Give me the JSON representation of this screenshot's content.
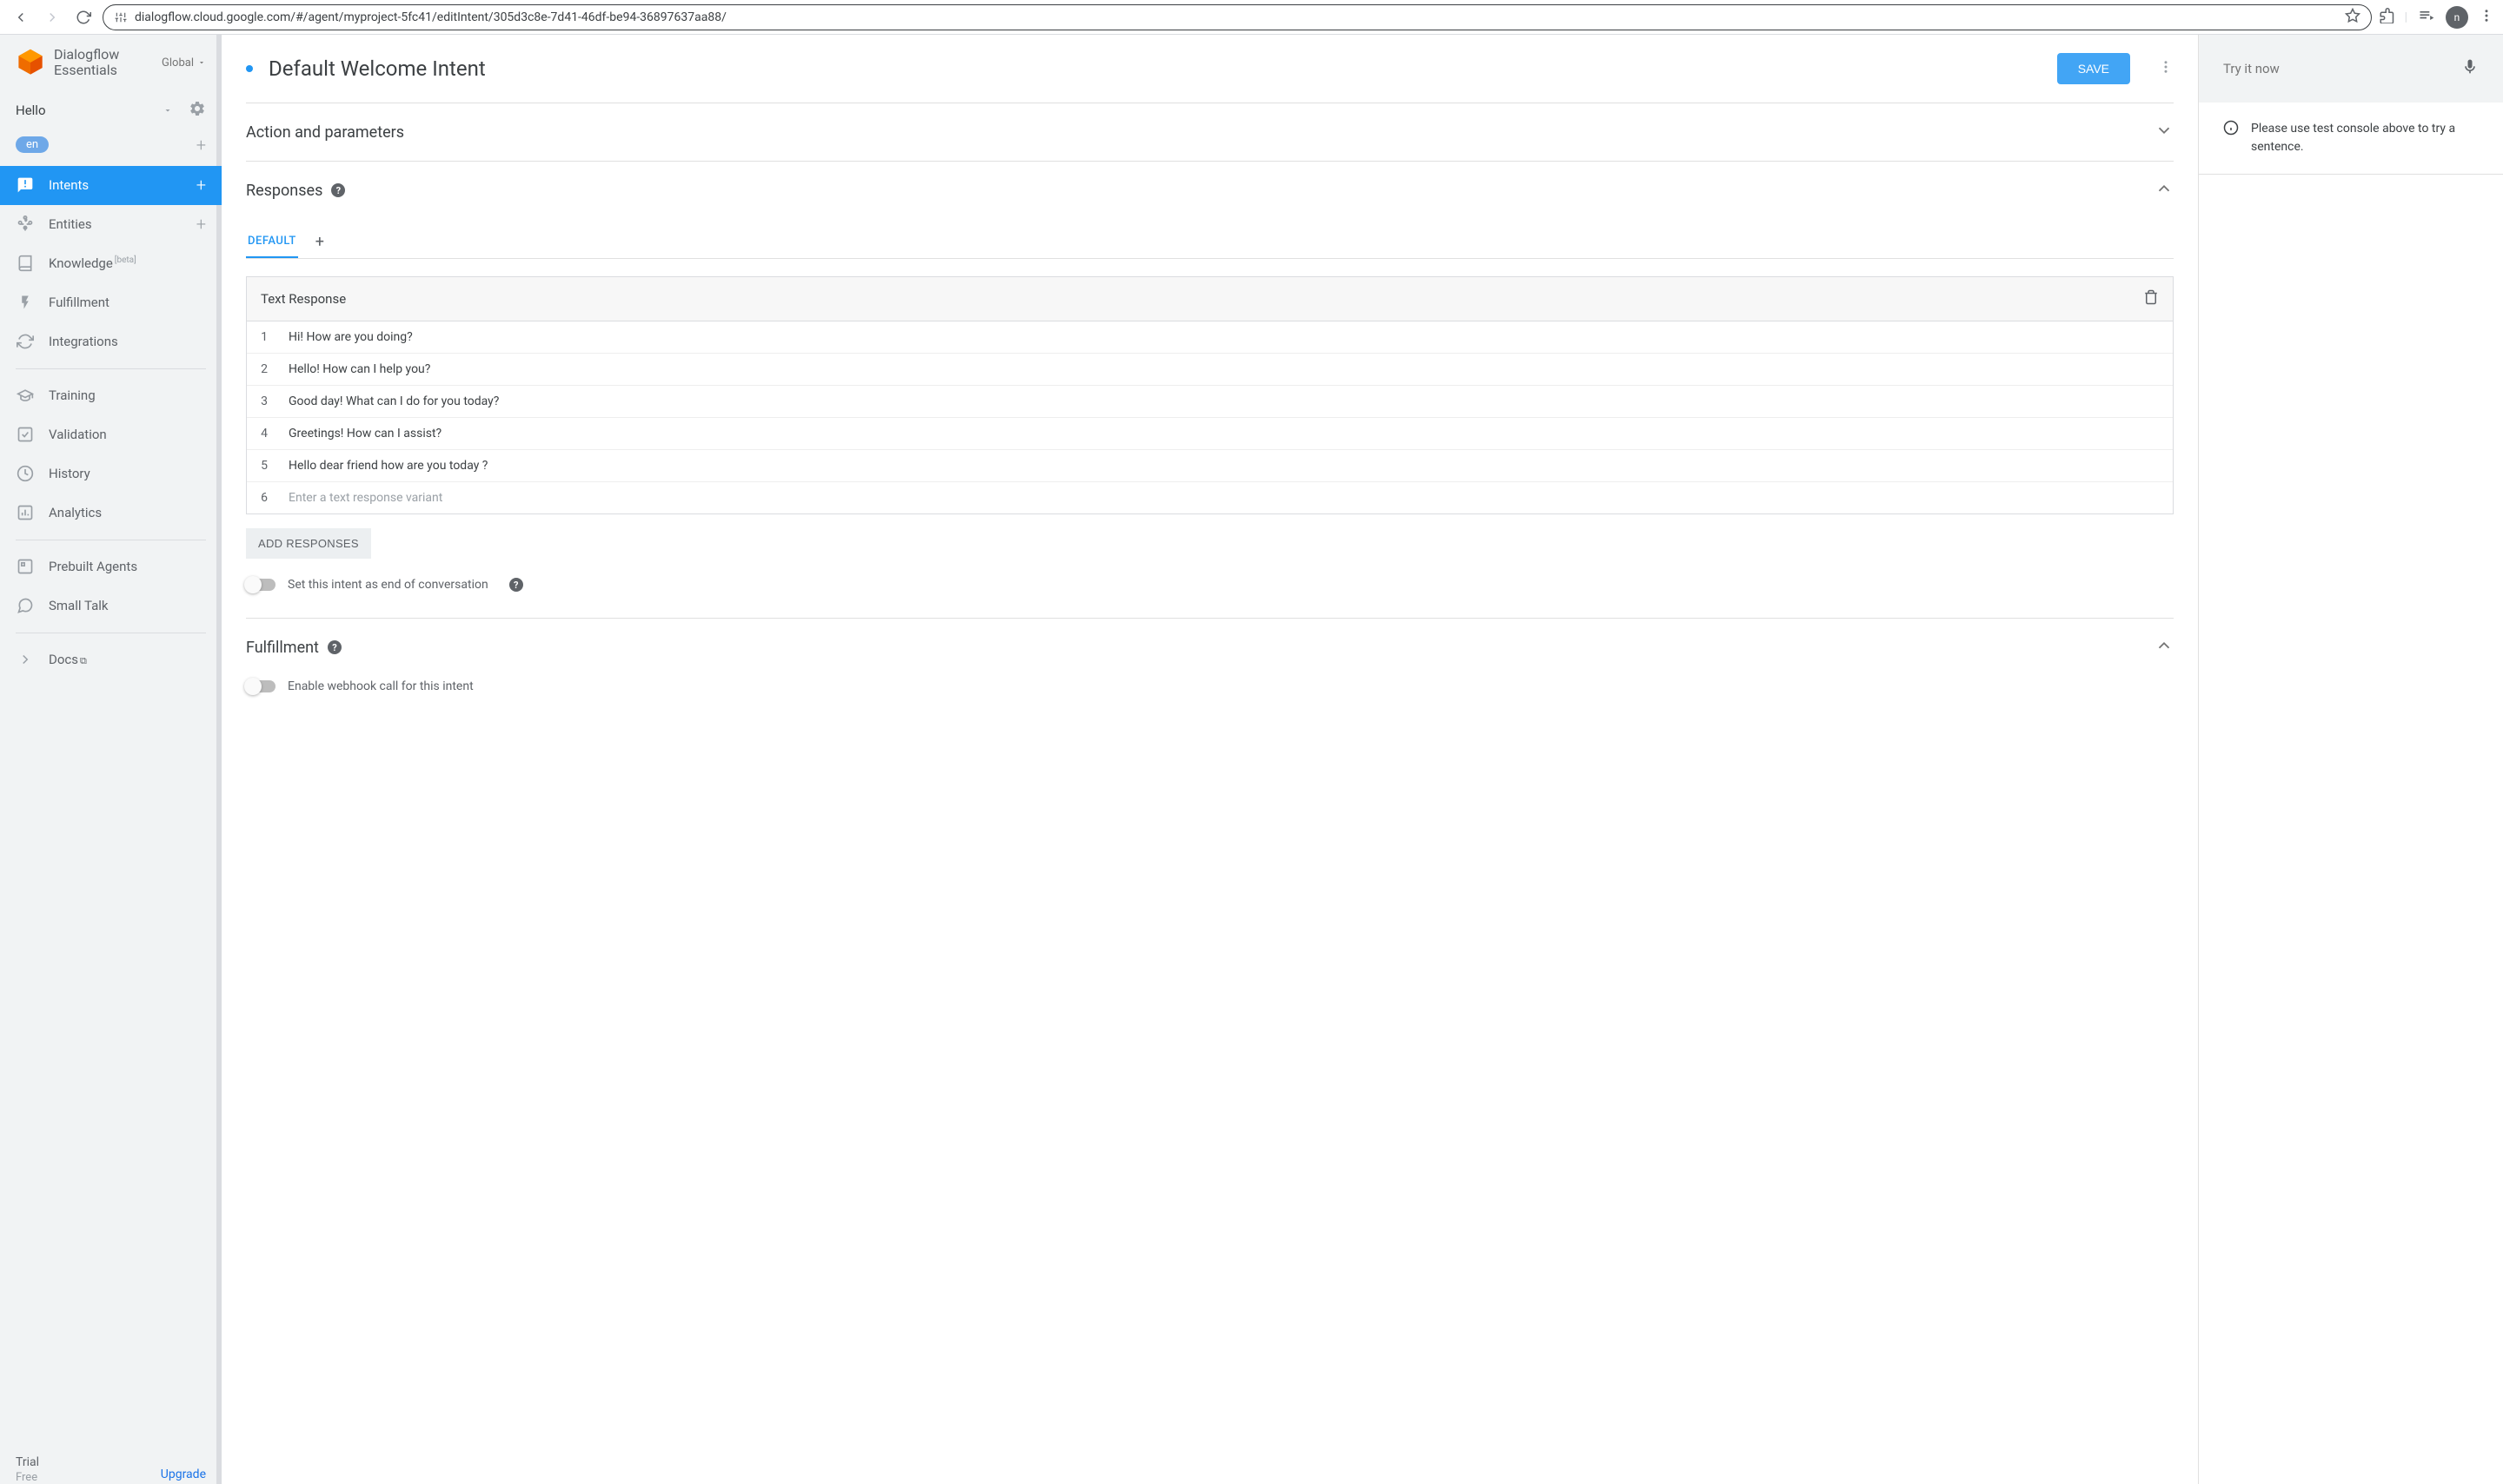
{
  "browser": {
    "url": "dialogflow.cloud.google.com/#/agent/myproject-5fc41/editIntent/305d3c8e-7d41-46df-be94-36897637aa88/",
    "avatar_letter": "n"
  },
  "logo": {
    "line1": "Dialogflow",
    "line2": "Essentials",
    "scope": "Global"
  },
  "agent": {
    "name": "Hello",
    "lang": "en"
  },
  "nav": {
    "intents": "Intents",
    "entities": "Entities",
    "knowledge": "Knowledge",
    "knowledge_tag": "[beta]",
    "fulfillment": "Fulfillment",
    "integrations": "Integrations",
    "training": "Training",
    "validation": "Validation",
    "history": "History",
    "analytics": "Analytics",
    "prebuilt": "Prebuilt Agents",
    "smalltalk": "Small Talk",
    "docs": "Docs"
  },
  "footer": {
    "trial": "Trial",
    "free": "Free",
    "upgrade": "Upgrade"
  },
  "header": {
    "title": "Default Welcome Intent",
    "save": "SAVE"
  },
  "sections": {
    "action_params": "Action and parameters",
    "responses": "Responses",
    "fulfillment": "Fulfillment"
  },
  "responses": {
    "tab_default": "DEFAULT",
    "card_title": "Text Response",
    "rows": [
      "Hi! How are you doing?",
      "Hello! How can I help you?",
      "Good day! What can I do for you today?",
      "Greetings! How can I assist?",
      "Hello dear friend how are you today ?"
    ],
    "placeholder": "Enter a text response variant",
    "add_btn": "ADD RESPONSES",
    "end_conv": "Set this intent as end of conversation"
  },
  "fulfillment": {
    "webhook_toggle": "Enable webhook call for this intent"
  },
  "try": {
    "label": "Try it now",
    "message": "Please use test console above to try a sentence."
  }
}
